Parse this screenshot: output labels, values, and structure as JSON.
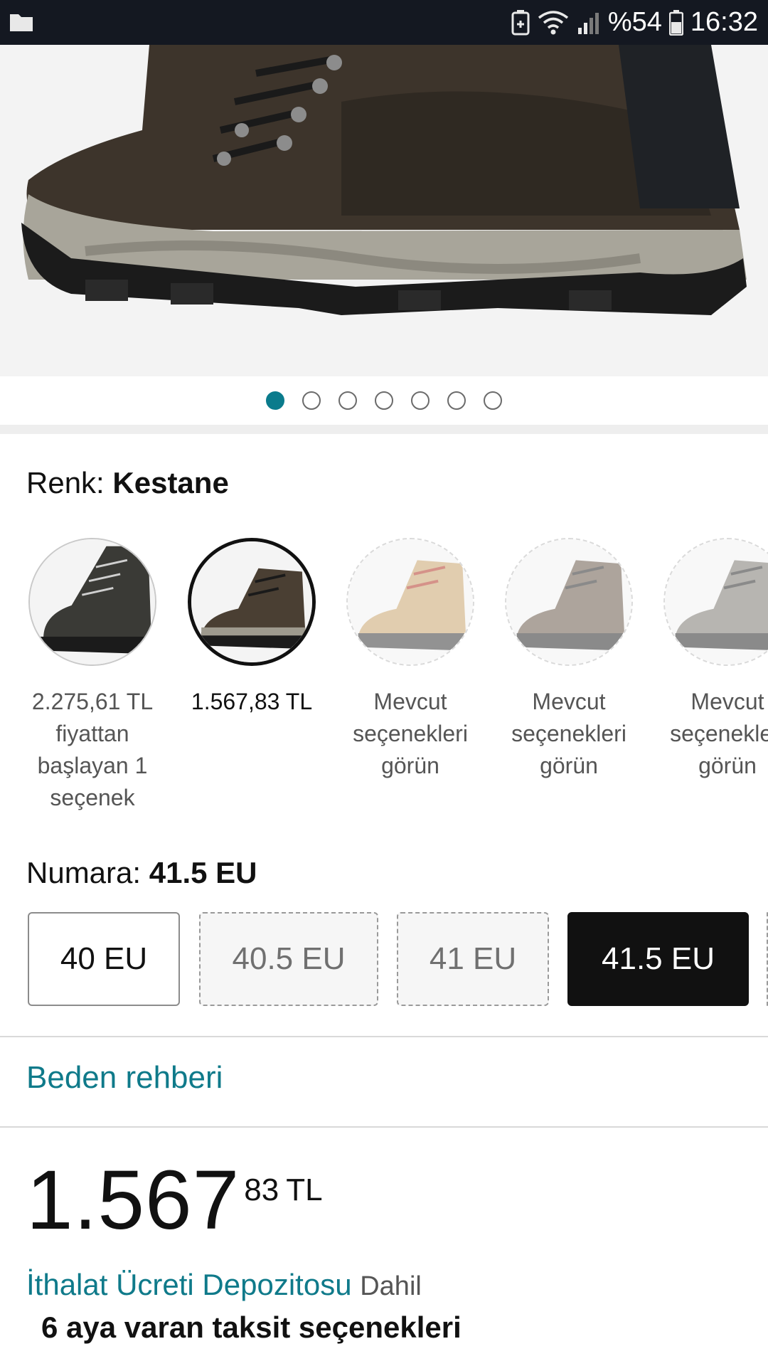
{
  "status_bar": {
    "battery_percent": "%54",
    "time": "16:32",
    "icons": [
      "folder-icon",
      "battery-saver-icon",
      "wifi-icon",
      "signal-icon",
      "battery-icon"
    ]
  },
  "gallery": {
    "image_count": 7,
    "active_index": 0
  },
  "color": {
    "label": "Renk:",
    "selected_value": "Kestane",
    "options": [
      {
        "caption": "2.275,61 TL fiyattan başlayan 1 seçenek",
        "state": "available",
        "tone": "#3a3a36"
      },
      {
        "caption": "1.567,83 TL",
        "state": "selected",
        "tone": "#4a3f33"
      },
      {
        "caption": "Mevcut seçenekleri görün",
        "state": "unavailable",
        "tone": "#c9a56f"
      },
      {
        "caption": "Mevcut seçenekleri görün",
        "state": "unavailable",
        "tone": "#6b5a4c"
      },
      {
        "caption": "Mevcut seçenekleri görün",
        "state": "unavailable",
        "tone": "#7d7a72"
      }
    ]
  },
  "size": {
    "label": "Numara:",
    "selected_value": "41.5 EU",
    "options": [
      {
        "label": "40 EU",
        "state": "available"
      },
      {
        "label": "40.5 EU",
        "state": "unavailable"
      },
      {
        "label": "41 EU",
        "state": "unavailable"
      },
      {
        "label": "41.5 EU",
        "state": "selected"
      }
    ]
  },
  "size_guide": {
    "label": "Beden rehberi"
  },
  "price": {
    "whole": "1.567",
    "cents": "83",
    "currency": "TL"
  },
  "import_fee": {
    "link": "İthalat Ücreti Depozitosu",
    "suffix": "Dahil"
  },
  "installment": {
    "text": "6 aya varan taksit seçenekleri"
  },
  "colors": {
    "accent": "#0a7b8c",
    "link": "#0f7a8a",
    "status_bar_bg": "#141821",
    "selected_size_bg": "#111111"
  }
}
